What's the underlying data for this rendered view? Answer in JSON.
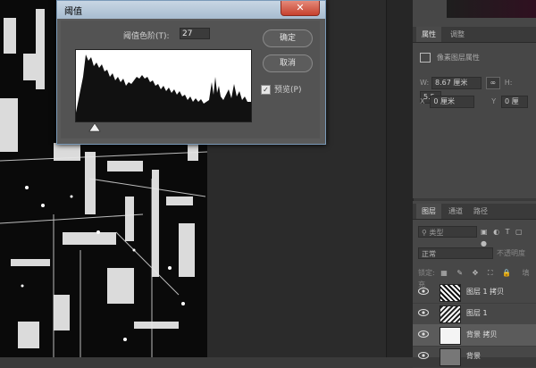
{
  "dialog": {
    "title": "阈值",
    "close": "✕",
    "threshold_label": "阈值色阶(T):",
    "threshold_value": "27",
    "ok_label": "确定",
    "cancel_label": "取消",
    "preview_label": "预览(P)",
    "preview_checked": true
  },
  "properties": {
    "tabs": [
      "属性",
      "调整"
    ],
    "pixel_layer_label": "像素图层属性",
    "w_label": "W:",
    "w_value": "8.67 厘米",
    "h_label": "H:",
    "h_value": "5.5",
    "x_label": "X",
    "x_value": "0 厘米",
    "y_label": "Y",
    "y_value": "0 厘"
  },
  "layers": {
    "tabs": [
      "图层",
      "通道",
      "路径"
    ],
    "filter_label": "类型",
    "blend_mode": "正常",
    "opacity_label": "不透明度",
    "lock_label": "锁定:",
    "fill_label": "填充",
    "items": [
      {
        "name": "图层 1 拷贝"
      },
      {
        "name": "图层 1"
      },
      {
        "name": "背景 拷贝"
      },
      {
        "name": "背景"
      }
    ]
  }
}
